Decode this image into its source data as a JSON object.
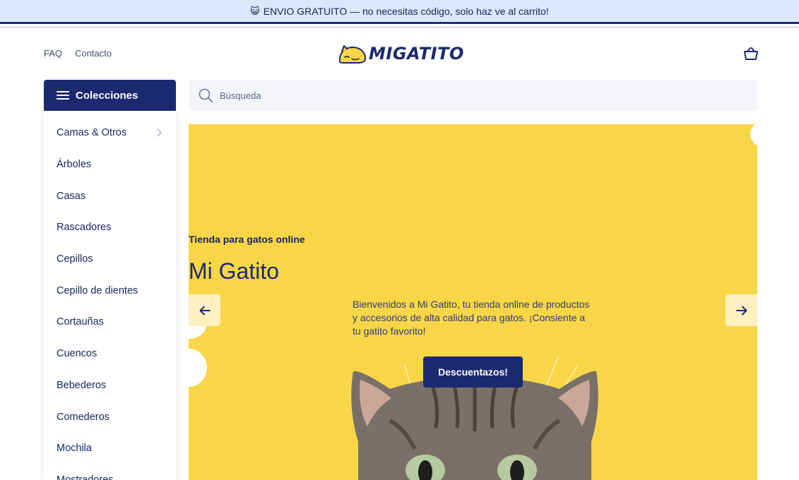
{
  "announcement": {
    "emoji": "😺",
    "text": "ENVIO GRATUITO — no necesitas código, solo haz ve al carrito!"
  },
  "nav": {
    "faq": "FAQ",
    "contact": "Contacto"
  },
  "brand": {
    "name": "MIGATITO"
  },
  "collections": {
    "label": "Colecciones",
    "items": [
      {
        "label": "Camas & Otros",
        "has_submenu": true
      },
      {
        "label": "Árboles"
      },
      {
        "label": "Casas"
      },
      {
        "label": "Rascadores"
      },
      {
        "label": "Cepillos"
      },
      {
        "label": "Cepillo de dientes"
      },
      {
        "label": "Cortauñas"
      },
      {
        "label": "Cuencos"
      },
      {
        "label": "Bebederos"
      },
      {
        "label": "Comederos"
      },
      {
        "label": "Mochila"
      },
      {
        "label": "Mostradores"
      }
    ]
  },
  "search": {
    "placeholder": "Búsqueda"
  },
  "hero": {
    "kicker": "Tienda para gatos online",
    "title": "Mi Gatito",
    "description": "Bienvenidos a Mi Gatito, tu tienda online de productos y accesorios de alta calidad para gatos. ¡Consiente a tu gatito favorito!",
    "cta": "Descuentazos!"
  },
  "colors": {
    "primary": "#1b2a6e",
    "hero_background": "#f9d648",
    "announcement_background": "#dbe8fb",
    "search_background": "#f3f5f9"
  },
  "icons": {
    "cart": "basket-icon",
    "search": "search-icon",
    "menu": "hamburger-icon",
    "prev": "arrow-left-icon",
    "next": "arrow-right-icon"
  }
}
